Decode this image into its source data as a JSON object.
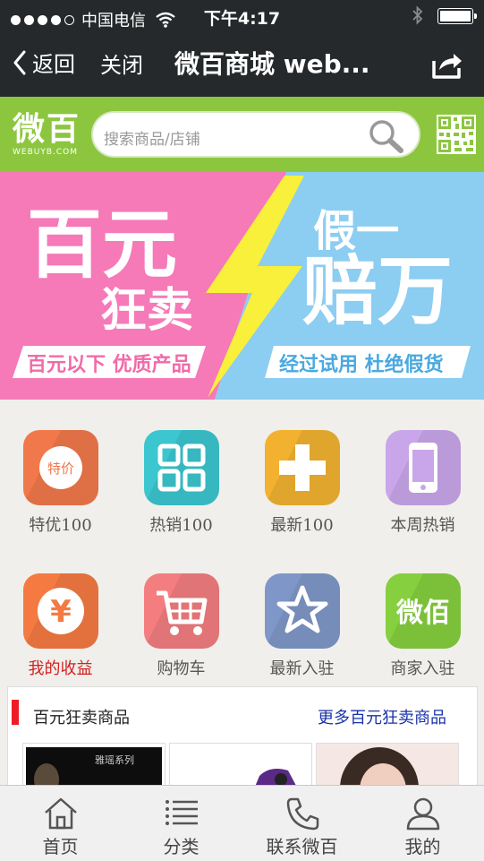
{
  "status": {
    "carrier": "中国电信",
    "time": "下午4:17"
  },
  "nav": {
    "back": "返回",
    "close": "关闭",
    "title": "微百商城 web..."
  },
  "header": {
    "logo_cn": "微百",
    "logo_en": "WEBUYB.COM",
    "search_placeholder": "搜索商品/店铺"
  },
  "banner": {
    "left_big1": "百元",
    "left_big2": "狂卖",
    "left_tag": "百元以下 优质产品",
    "right_small": "假一",
    "right_big": "赔万",
    "right_tag": "经过试用 杜绝假货"
  },
  "grid": [
    {
      "label": "特优100",
      "icon": "tag-icon",
      "icon_text": "特价",
      "color": "#f0784a"
    },
    {
      "label": "热销100",
      "icon": "grid-icon",
      "color": "#3cc6cf"
    },
    {
      "label": "最新100",
      "icon": "plus-icon",
      "color": "#f2b230"
    },
    {
      "label": "本周热销",
      "icon": "phone-icon",
      "color": "#c9a6ea"
    },
    {
      "label": "我的收益",
      "icon": "yen-icon",
      "icon_text": "¥",
      "color": "#f47a42",
      "highlight": true
    },
    {
      "label": "购物车",
      "icon": "cart-icon",
      "color": "#f37d7f"
    },
    {
      "label": "最新入驻",
      "icon": "star-icon",
      "color": "#7f97c8"
    },
    {
      "label": "商家入驻",
      "icon": "merchant-icon",
      "icon_text": "微佰",
      "color": "#86cf3f"
    }
  ],
  "section": {
    "title": "百元狂卖商品",
    "more": "更多百元狂卖商品",
    "thumb1_text": "雅瑶系列"
  },
  "tabs": [
    {
      "label": "首页",
      "icon": "home-icon"
    },
    {
      "label": "分类",
      "icon": "list-icon"
    },
    {
      "label": "联系微百",
      "icon": "phone-call-icon"
    },
    {
      "label": "我的",
      "icon": "user-icon"
    }
  ]
}
